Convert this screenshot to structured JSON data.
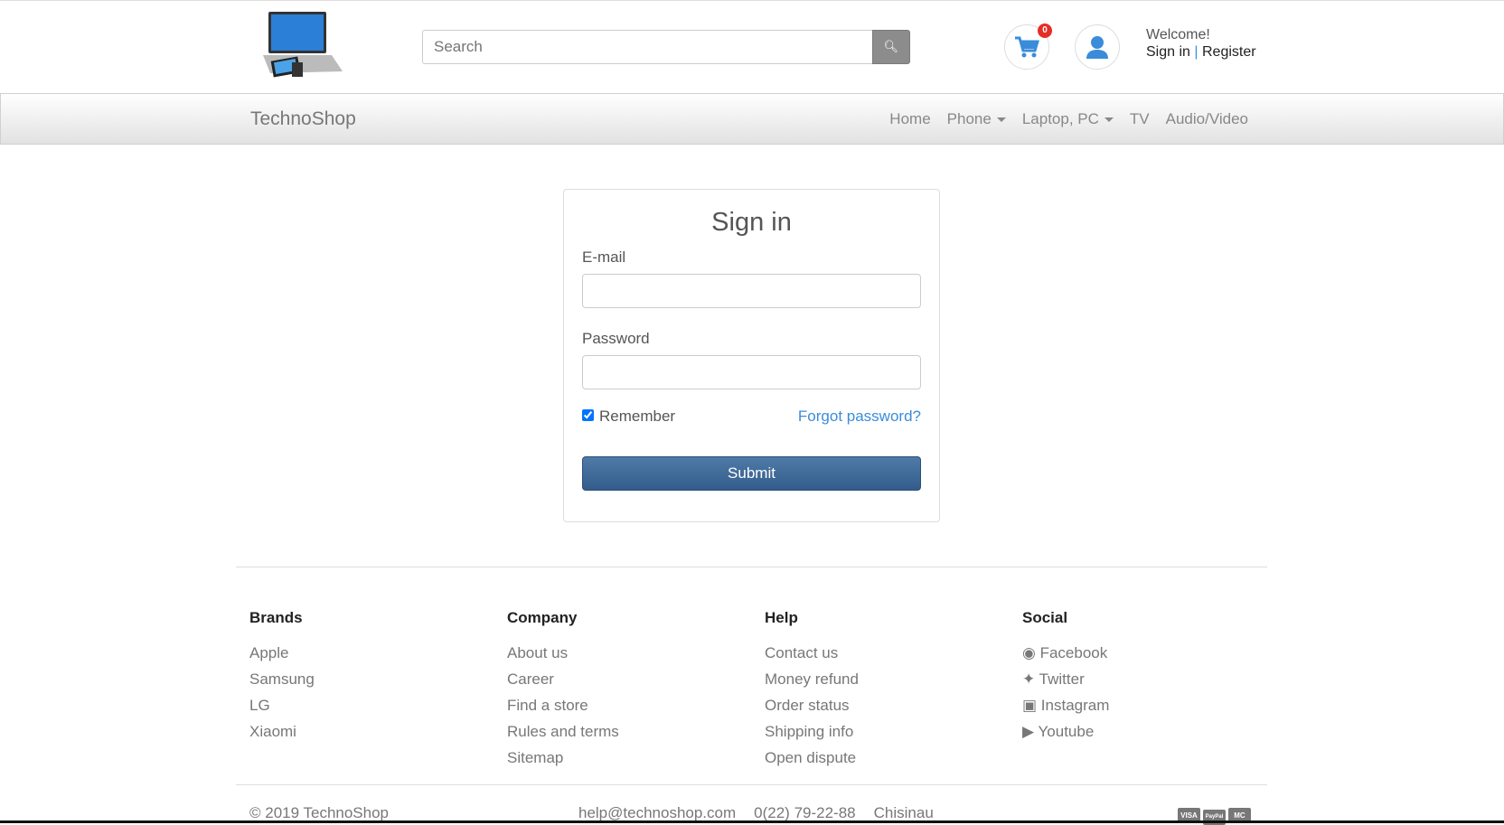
{
  "header": {
    "search_placeholder": "Search",
    "cart_count": "0",
    "welcome": "Welcome!",
    "sign_in": "Sign in",
    "separator": "|",
    "register": "Register"
  },
  "nav": {
    "brand": "TechnoShop",
    "links": [
      "Home",
      "Phone",
      "Laptop, PC",
      "TV",
      "Audio/Video"
    ]
  },
  "form": {
    "title": "Sign in",
    "email_label": "E-mail",
    "password_label": "Password",
    "remember": "Remember",
    "remember_checked": true,
    "forgot": "Forgot password?",
    "submit": "Submit"
  },
  "footer": {
    "brands": {
      "title": "Brands",
      "items": [
        "Apple",
        "Samsung",
        "LG",
        "Xiaomi"
      ]
    },
    "company": {
      "title": "Company",
      "items": [
        "About us",
        "Career",
        "Find a store",
        "Rules and terms",
        "Sitemap"
      ]
    },
    "help": {
      "title": "Help",
      "items": [
        "Contact us",
        "Money refund",
        "Order status",
        "Shipping info",
        "Open dispute"
      ]
    },
    "social": {
      "title": "Social",
      "items": [
        "Facebook",
        "Twitter",
        "Instagram",
        "Youtube"
      ]
    },
    "copyright": "© 2019 TechnoShop",
    "email": "help@technoshop.com",
    "phone": "0(22) 79-22-88",
    "city": "Chisinau",
    "payments": [
      "VISA",
      "PayPal",
      "MC"
    ]
  },
  "colors": {
    "accent": "#3a8cdb",
    "submit": "#3d6794",
    "badge": "#e52d27"
  }
}
